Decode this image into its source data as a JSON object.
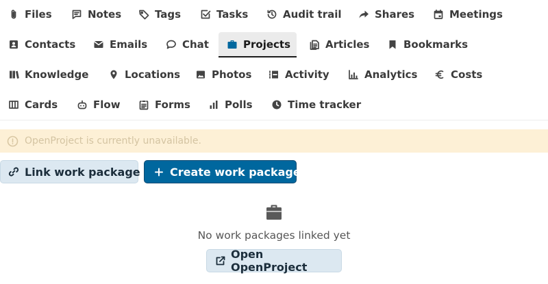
{
  "tabs": [
    {
      "label": "Files",
      "icon": "paperclip-icon"
    },
    {
      "label": "Notes",
      "icon": "note-icon"
    },
    {
      "label": "Tags",
      "icon": "tag-icon"
    },
    {
      "label": "Tasks",
      "icon": "checkbox-icon"
    },
    {
      "label": "Audit trail",
      "icon": "history-icon"
    },
    {
      "label": "Shares",
      "icon": "share-icon"
    },
    {
      "label": "Meetings",
      "icon": "calendar-icon"
    },
    {
      "label": "Contacts",
      "icon": "contact-card-icon"
    },
    {
      "label": "Emails",
      "icon": "envelope-icon"
    },
    {
      "label": "Chat",
      "icon": "chat-bubble-icon"
    },
    {
      "label": "Projects",
      "icon": "briefcase-icon",
      "active": true
    },
    {
      "label": "Articles",
      "icon": "articles-icon"
    },
    {
      "label": "Bookmarks",
      "icon": "bookmark-icon"
    },
    {
      "label": "Knowledge",
      "icon": "book-icon"
    },
    {
      "label": "Locations",
      "icon": "map-pin-icon"
    },
    {
      "label": "Photos",
      "icon": "image-icon"
    },
    {
      "label": "Activity",
      "icon": "activity-icon"
    },
    {
      "label": "Analytics",
      "icon": "bar-chart-icon"
    },
    {
      "label": "Costs",
      "icon": "euro-icon"
    },
    {
      "label": "Cards",
      "icon": "columns-icon"
    },
    {
      "label": "Flow",
      "icon": "robot-icon"
    },
    {
      "label": "Forms",
      "icon": "clipboard-icon"
    },
    {
      "label": "Polls",
      "icon": "poll-icon"
    },
    {
      "label": "Time tracker",
      "icon": "clock-icon"
    }
  ],
  "notice": {
    "text": "OpenProject is currently unavailable.",
    "icon": "info-icon"
  },
  "actions": {
    "link_label": "Link work package",
    "create_label": "Create work package"
  },
  "empty_state": {
    "icon": "briefcase-icon",
    "text": "No work packages linked yet",
    "open_label": "Open OpenProject"
  },
  "colors": {
    "accent": "#00679e",
    "notice_bg": "#fdf0d6",
    "secondary_button_bg": "#dce8f1"
  }
}
